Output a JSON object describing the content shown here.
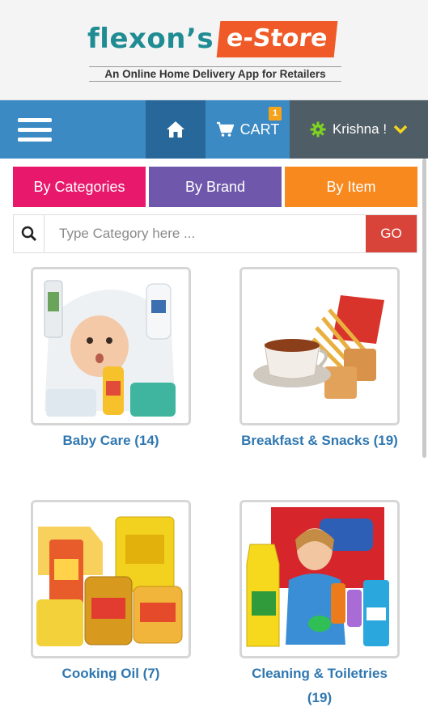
{
  "header": {
    "logo_main": "flexon’s",
    "logo_store": "e-Store",
    "tagline": "An Online Home Delivery App for Retailers"
  },
  "nav": {
    "cart_label": "CART",
    "cart_count": "1",
    "user_name": "Krishna !"
  },
  "tabs": [
    {
      "label": "By Categories"
    },
    {
      "label": "By Brand"
    },
    {
      "label": "By Item"
    }
  ],
  "search": {
    "placeholder": "Type Category here ...",
    "value": "",
    "go_label": "GO"
  },
  "categories": [
    {
      "label": "Baby Care (14)",
      "icon": "baby-care-image"
    },
    {
      "label": "Breakfast & Snacks (19)",
      "icon": "breakfast-snacks-image"
    },
    {
      "label": "Cooking Oil (7)",
      "icon": "cooking-oil-image"
    },
    {
      "label": "Cleaning & Toiletries (19)",
      "icon": "cleaning-toiletries-image"
    }
  ],
  "colors": {
    "brand_teal": "#1f8c93",
    "brand_orange": "#f05a28",
    "nav_blue": "#3b8ac4",
    "tab_pink": "#e8196c",
    "tab_purple": "#6f58ab",
    "tab_orange": "#f7891f",
    "go_red": "#d9443a",
    "label_blue": "#2f77b0"
  }
}
